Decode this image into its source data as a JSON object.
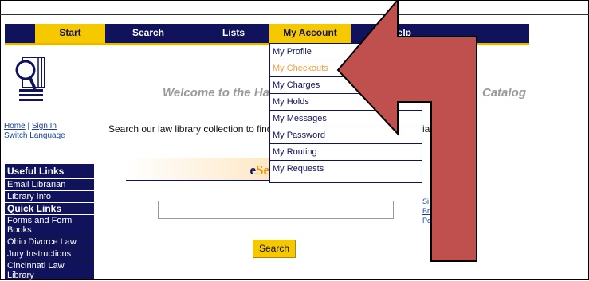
{
  "nav": {
    "tabs": [
      "Start",
      "Search",
      "Lists",
      "My Account",
      "Help"
    ]
  },
  "account_menu": {
    "items": [
      "My Profile",
      "My Checkouts",
      "My Charges",
      "My Holds",
      "My Messages",
      "My Password",
      "My Routing",
      "My Requests"
    ],
    "highlighted": "My Checkouts"
  },
  "header": {
    "welcome_left": "Welcome to the Ha",
    "welcome_right": "Catalog"
  },
  "home_links": {
    "home": "Home",
    "separator": "|",
    "sign_in": "Sign In",
    "switch_language": "Switch Language"
  },
  "intro": {
    "text": "Search our law library collection to find p",
    "text_right": "ia"
  },
  "sidebar": {
    "useful_links_heading": "Useful Links",
    "useful_links": [
      "Email Librarian",
      "Library Info"
    ],
    "quick_links_heading": "Quick Links",
    "quick_links": [
      "Forms and Form Books",
      "Ohio Divorce Law",
      "Jury Instructions",
      "Cincinnati Law Library"
    ]
  },
  "esearch": {
    "prefix": "e",
    "highlight": "Se"
  },
  "search": {
    "input_value": "",
    "button_label": "Search"
  },
  "right_links": [
    "Si",
    "Br",
    "Po"
  ],
  "colors": {
    "nav_bg": "#10135c",
    "accent": "#f5c800",
    "arrow": "#c0504d"
  }
}
